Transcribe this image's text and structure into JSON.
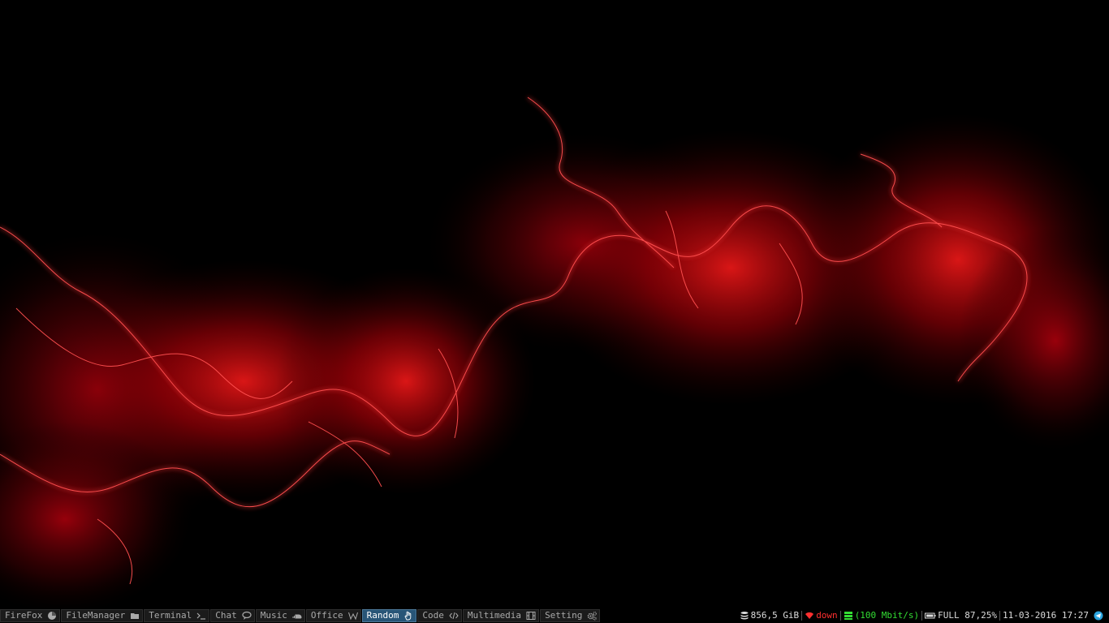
{
  "workspaces": [
    {
      "label": "FireFox",
      "icon": "firefox-icon",
      "active": false
    },
    {
      "label": "FileManager",
      "icon": "folder-icon",
      "active": false
    },
    {
      "label": "Terminal",
      "icon": "terminal-icon",
      "active": false
    },
    {
      "label": "Chat",
      "icon": "chat-bubble-icon",
      "active": false
    },
    {
      "label": "Music",
      "icon": "soundcloud-icon",
      "active": false
    },
    {
      "label": "Office",
      "icon": "wikipedia-w-icon",
      "active": false
    },
    {
      "label": "Random",
      "icon": "hand-pointer-icon",
      "active": true
    },
    {
      "label": "Code",
      "icon": "code-icon",
      "active": false
    },
    {
      "label": "Multimedia",
      "icon": "film-icon",
      "active": false
    },
    {
      "label": "Setting",
      "icon": "cogs-icon",
      "active": false
    }
  ],
  "status": {
    "disk": {
      "value": "856,5 GiB",
      "icon": "database-icon"
    },
    "wifi": {
      "value": "down",
      "icon": "wifi-icon",
      "color": "#ff3030"
    },
    "ethernet": {
      "value": "(100 Mbit/s)",
      "icon": "ethernet-icon",
      "color": "#33dd33"
    },
    "battery": {
      "value": "FULL 87,25%",
      "icon": "battery-icon"
    },
    "datetime": "11-03-2016 17:27",
    "tray": {
      "icon": "telegram-icon",
      "color": "#2ca5e0"
    }
  },
  "colors": {
    "bar_background": "#000000",
    "active_workspace": "#285577",
    "inactive_workspace": "#1b1b1b",
    "wallpaper_accent": "#e0101a"
  }
}
